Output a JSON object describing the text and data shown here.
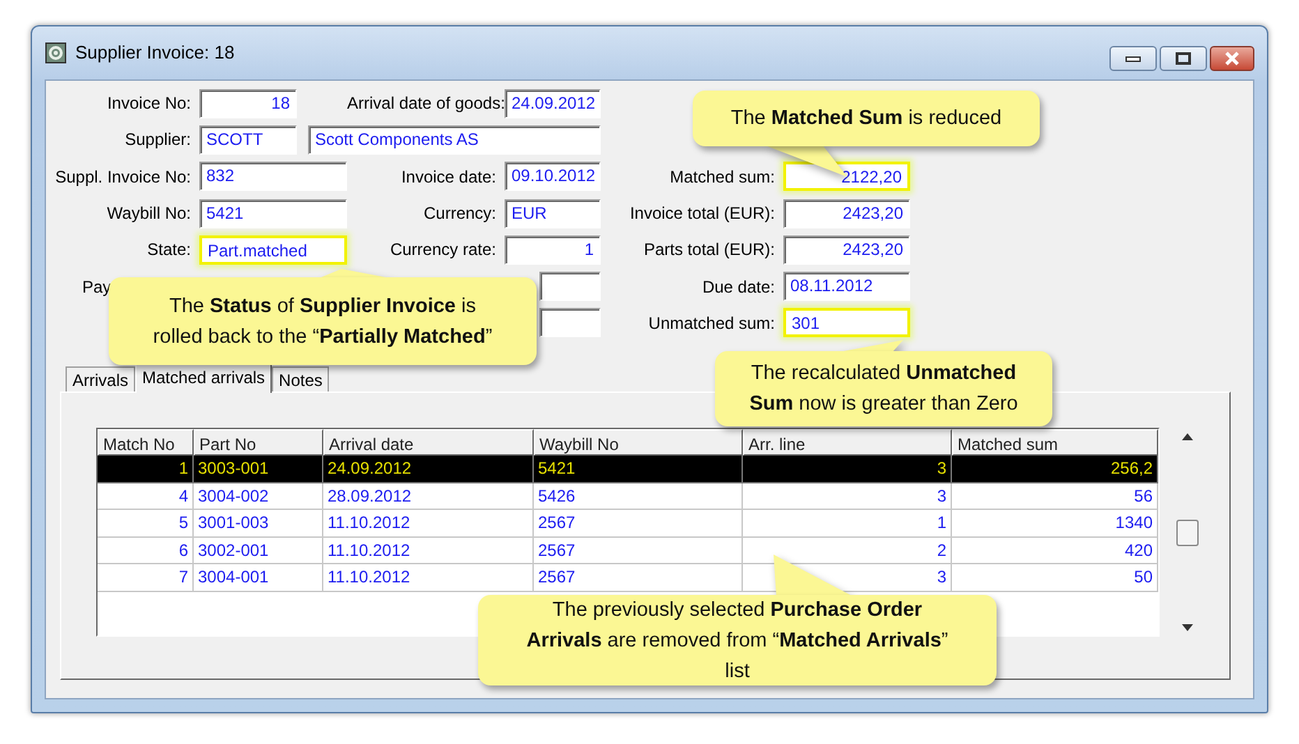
{
  "window": {
    "title": "Supplier Invoice: 18"
  },
  "form": {
    "rows": [
      {
        "left": {
          "label": "Invoice No:",
          "value": "18",
          "kind": "number",
          "highlighted": false
        },
        "middle": {
          "label": "Arrival date of goods:",
          "value": "24.09.2012",
          "kind": "text",
          "highlighted": false
        }
      },
      {
        "left": {
          "label": "Supplier:",
          "value": "SCOTT",
          "kind": "text",
          "highlighted": false
        },
        "wide": {
          "value": "Scott Components AS",
          "highlighted": false
        }
      },
      {
        "left": {
          "label": "Suppl. Invoice No:",
          "value": "832",
          "kind": "text",
          "highlighted": false
        },
        "middle": {
          "label": "Invoice date:",
          "value": "09.10.2012",
          "kind": "text",
          "highlighted": false
        },
        "right": {
          "label": "Matched sum:",
          "value": "2122,20",
          "kind": "number",
          "highlighted": true
        }
      },
      {
        "left": {
          "label": "Waybill No:",
          "value": "5421",
          "kind": "text",
          "highlighted": false
        },
        "middle": {
          "label": "Currency:",
          "value": "EUR",
          "kind": "text",
          "highlighted": false
        },
        "right": {
          "label": "Invoice total (EUR):",
          "value": "2423,20",
          "kind": "number",
          "highlighted": false
        }
      },
      {
        "left": {
          "label": "State:",
          "value": "Part.matched",
          "kind": "text",
          "highlighted": true
        },
        "middle": {
          "label": "Currency rate:",
          "value": "1",
          "kind": "number",
          "highlighted": false
        },
        "right": {
          "label": "Parts total (EUR):",
          "value": "2423,20",
          "kind": "number",
          "highlighted": false
        }
      },
      {
        "left": {
          "label": "Pay"
        },
        "middle": {
          "kind": "text",
          "highlighted": false
        },
        "right": {
          "label": "Due date:",
          "value": "08.11.2012",
          "kind": "text",
          "highlighted": false
        }
      },
      {
        "middle": {
          "kind": "text",
          "highlighted": false
        },
        "right": {
          "label": "Unmatched sum:",
          "value": "301",
          "kind": "text",
          "highlighted": true
        }
      }
    ]
  },
  "tabs": [
    {
      "label": "Arrivals",
      "selected": false
    },
    {
      "label": "Matched arrivals",
      "selected": true
    },
    {
      "label": "Notes",
      "selected": false
    }
  ],
  "table": {
    "columns": [
      "Match No",
      "Part No",
      "Arrival date",
      "Waybill No",
      "Arr. line",
      "Matched sum"
    ],
    "rows": [
      {
        "cells": [
          "1",
          "3003-001",
          "24.09.2012",
          "5421",
          "3",
          "256,2"
        ],
        "selected": true
      },
      {
        "cells": [
          "4",
          "3004-002",
          "28.09.2012",
          "5426",
          "3",
          "56"
        ],
        "selected": false
      },
      {
        "cells": [
          "5",
          "3001-003",
          "11.10.2012",
          "2567",
          "1",
          "1340"
        ],
        "selected": false
      },
      {
        "cells": [
          "6",
          "3002-001",
          "11.10.2012",
          "2567",
          "2",
          "420"
        ],
        "selected": false
      },
      {
        "cells": [
          "7",
          "3004-001",
          "11.10.2012",
          "2567",
          "3",
          "50"
        ],
        "selected": false
      }
    ]
  },
  "callouts": [
    {
      "text": "The **Matched Sum** is reduced"
    },
    {
      "text": "The **Status** of **Supplier Invoice** is rolled back to the “**Partially Matched**”"
    },
    {
      "text": "The recalculated **Unmatched Sum** now is greater than Zero"
    },
    {
      "text": "The previously selected **Purchase Order Arrivals** are removed from “**Matched Arrivals**” list"
    }
  ]
}
